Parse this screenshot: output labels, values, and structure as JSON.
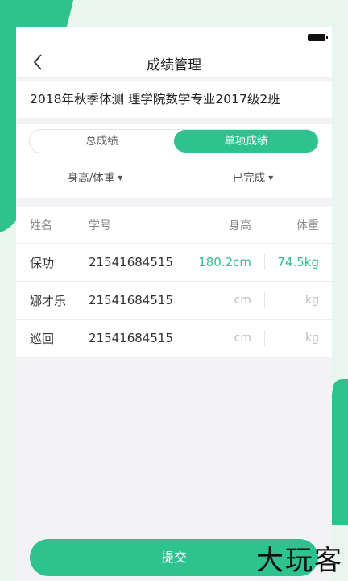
{
  "nav": {
    "title": "成绩管理"
  },
  "subtitle": "2018年秋季体测 理学院数学专业2017级2班",
  "tabs": [
    {
      "label": "总成绩",
      "active": false
    },
    {
      "label": "单项成绩",
      "active": true
    }
  ],
  "filters": [
    {
      "label": "身高/体重"
    },
    {
      "label": "已完成"
    }
  ],
  "table": {
    "headers": {
      "name": "姓名",
      "id": "学号",
      "height": "身高",
      "weight": "体重"
    },
    "rows": [
      {
        "name": "保功",
        "id": "21541684515",
        "height": "180.2cm",
        "weight": "74.5kg"
      },
      {
        "name": "娜才乐",
        "id": "21541684515",
        "height": "cm",
        "weight": "kg"
      },
      {
        "name": "巡回",
        "id": "21541684515",
        "height": "cm",
        "weight": "kg"
      }
    ]
  },
  "submit": {
    "label": "提交"
  },
  "watermark": "大玩客",
  "colors": {
    "accent": "#2ec28f",
    "background": "#e9f6f0"
  }
}
